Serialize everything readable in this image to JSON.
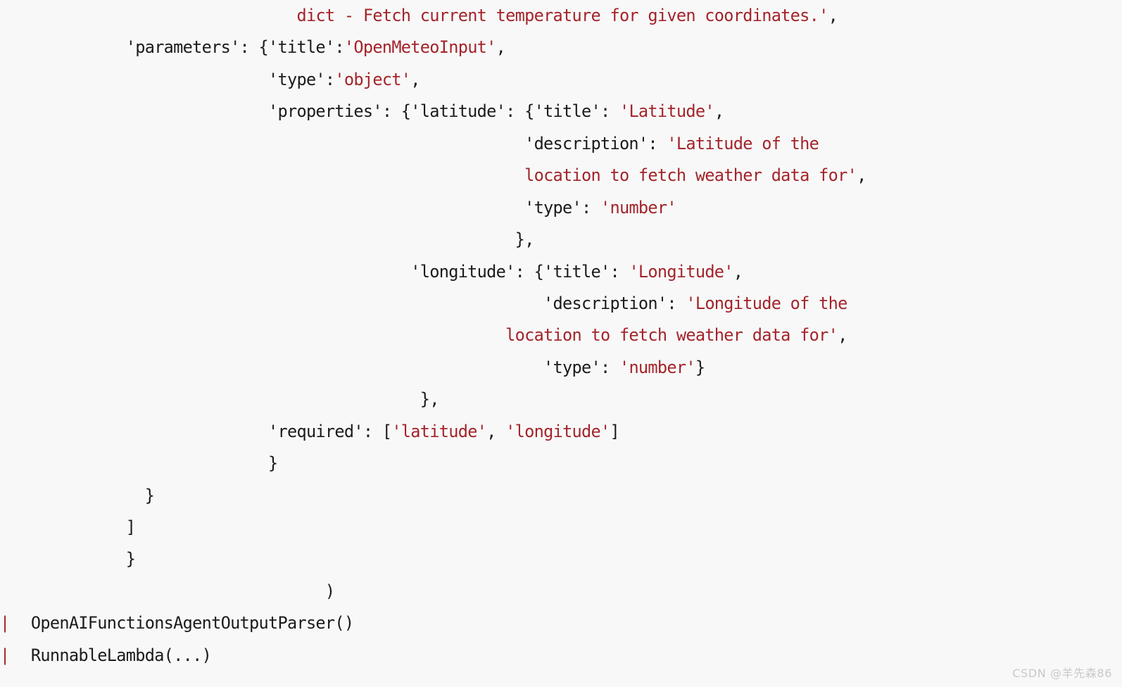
{
  "theme": {
    "background": "#f8f8f8",
    "text_color": "#1b1b1b",
    "string_color": "#a3242a",
    "gutter_bar_color": "#a3242a",
    "watermark_color": "#c9c9c9"
  },
  "code_output": {
    "language": "python-repr",
    "lines": [
      {
        "gutter": "",
        "segments": [
          {
            "text": "                              ",
            "type": "plain"
          },
          {
            "text": "dict - Fetch current temperature for given coordinates.'",
            "type": "string"
          },
          {
            "text": ",",
            "type": "plain"
          }
        ]
      },
      {
        "gutter": "",
        "segments": [
          {
            "text": "            'parameters': {'title':",
            "type": "plain"
          },
          {
            "text": "'OpenMeteoInput'",
            "type": "string"
          },
          {
            "text": ",",
            "type": "plain"
          }
        ]
      },
      {
        "gutter": "",
        "segments": [
          {
            "text": "                           'type':",
            "type": "plain"
          },
          {
            "text": "'object'",
            "type": "string"
          },
          {
            "text": ",",
            "type": "plain"
          }
        ]
      },
      {
        "gutter": "",
        "segments": [
          {
            "text": "                           'properties': {'latitude': {'title': ",
            "type": "plain"
          },
          {
            "text": "'Latitude'",
            "type": "string"
          },
          {
            "text": ",",
            "type": "plain"
          }
        ]
      },
      {
        "gutter": "",
        "segments": [
          {
            "text": "                                                      'description': ",
            "type": "plain"
          },
          {
            "text": "'Latitude of the",
            "type": "string"
          }
        ]
      },
      {
        "gutter": "",
        "segments": [
          {
            "text": "                                                      ",
            "type": "plain"
          },
          {
            "text": "location to fetch weather data for'",
            "type": "string"
          },
          {
            "text": ",",
            "type": "plain"
          }
        ]
      },
      {
        "gutter": "",
        "segments": [
          {
            "text": "                                                      'type': ",
            "type": "plain"
          },
          {
            "text": "'number'",
            "type": "string"
          }
        ]
      },
      {
        "gutter": "",
        "segments": [
          {
            "text": "                                                     },",
            "type": "plain"
          }
        ]
      },
      {
        "gutter": "",
        "segments": [
          {
            "text": "                                          'longitude': {'title': ",
            "type": "plain"
          },
          {
            "text": "'Longitude'",
            "type": "string"
          },
          {
            "text": ",",
            "type": "plain"
          }
        ]
      },
      {
        "gutter": "",
        "segments": [
          {
            "text": "                                                        'description': ",
            "type": "plain"
          },
          {
            "text": "'Longitude of the",
            "type": "string"
          }
        ]
      },
      {
        "gutter": "",
        "segments": [
          {
            "text": "                                                    ",
            "type": "plain"
          },
          {
            "text": "location to fetch weather data for'",
            "type": "string"
          },
          {
            "text": ",",
            "type": "plain"
          }
        ]
      },
      {
        "gutter": "",
        "segments": [
          {
            "text": "                                                        'type': ",
            "type": "plain"
          },
          {
            "text": "'number'",
            "type": "string"
          },
          {
            "text": "}",
            "type": "plain"
          }
        ]
      },
      {
        "gutter": "",
        "segments": [
          {
            "text": "                                           },",
            "type": "plain"
          }
        ]
      },
      {
        "gutter": "",
        "segments": [
          {
            "text": "                           'required': [",
            "type": "plain"
          },
          {
            "text": "'latitude'",
            "type": "string"
          },
          {
            "text": ", ",
            "type": "plain"
          },
          {
            "text": "'longitude'",
            "type": "string"
          },
          {
            "text": "]",
            "type": "plain"
          }
        ]
      },
      {
        "gutter": "",
        "segments": [
          {
            "text": "                           }",
            "type": "plain"
          }
        ]
      },
      {
        "gutter": "",
        "segments": [
          {
            "text": "              }",
            "type": "plain"
          }
        ]
      },
      {
        "gutter": "",
        "segments": [
          {
            "text": "            ]",
            "type": "plain"
          }
        ]
      },
      {
        "gutter": "",
        "segments": [
          {
            "text": "            }",
            "type": "plain"
          }
        ]
      },
      {
        "gutter": "",
        "segments": [
          {
            "text": "                                 )",
            "type": "plain"
          }
        ]
      },
      {
        "gutter": "|",
        "segments": [
          {
            "text": "  OpenAIFunctionsAgentOutputParser()",
            "type": "plain"
          }
        ]
      },
      {
        "gutter": "|",
        "segments": [
          {
            "text": "  RunnableLambda(...)",
            "type": "plain"
          }
        ]
      }
    ]
  },
  "watermark": {
    "text": "CSDN @羊先森86"
  }
}
